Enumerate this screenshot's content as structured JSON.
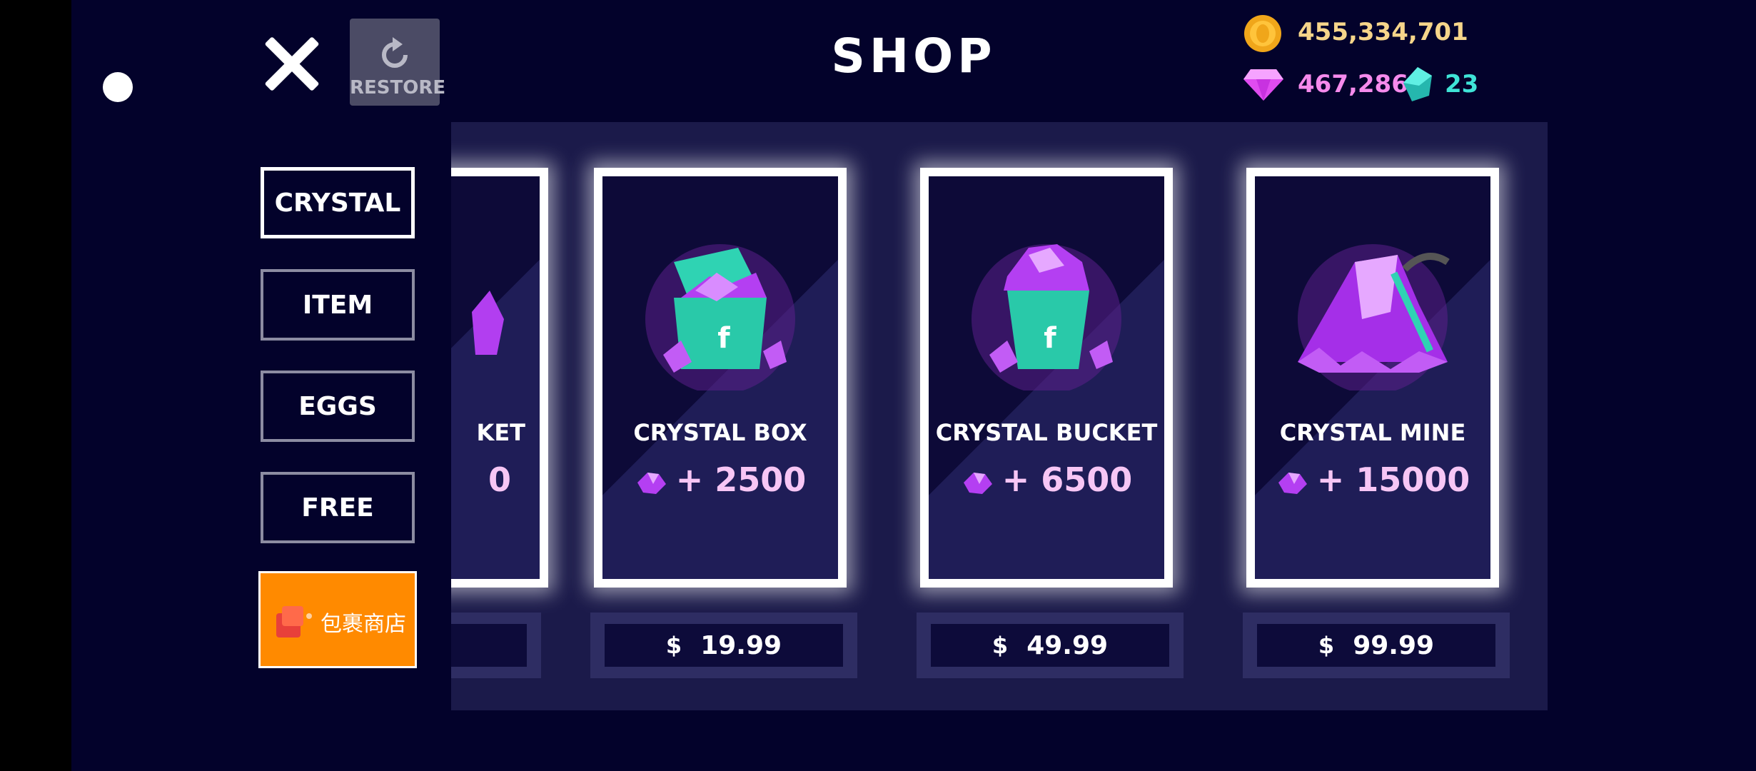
{
  "header": {
    "title": "SHOP",
    "restore_label": "RESTORE"
  },
  "currencies": {
    "coins": "455,334,701",
    "gems": "467,286",
    "shards": "23"
  },
  "tabs": [
    {
      "label": "CRYSTAL",
      "active": true
    },
    {
      "label": "ITEM",
      "active": false
    },
    {
      "label": "EGGS",
      "active": false
    },
    {
      "label": "FREE",
      "active": false
    }
  ],
  "package_store": {
    "label": "包裹商店"
  },
  "partial_card": {
    "name": "KET",
    "amount": "0"
  },
  "products": [
    {
      "name": "CRYSTAL BOX",
      "amount": "+ 2500",
      "price": "19.99"
    },
    {
      "name": "CRYSTAL BUCKET",
      "amount": "+ 6500",
      "price": "49.99"
    },
    {
      "name": "CRYSTAL MINE",
      "amount": "+ 15000",
      "price": "99.99"
    }
  ],
  "currency_symbol": "$",
  "colors": {
    "background": "#03022b",
    "panel": "#1b1a4a",
    "coin": "#f6d58a",
    "gem": "#f58aec",
    "shard": "#3fe4d7",
    "package_button": "#ff8a00"
  }
}
